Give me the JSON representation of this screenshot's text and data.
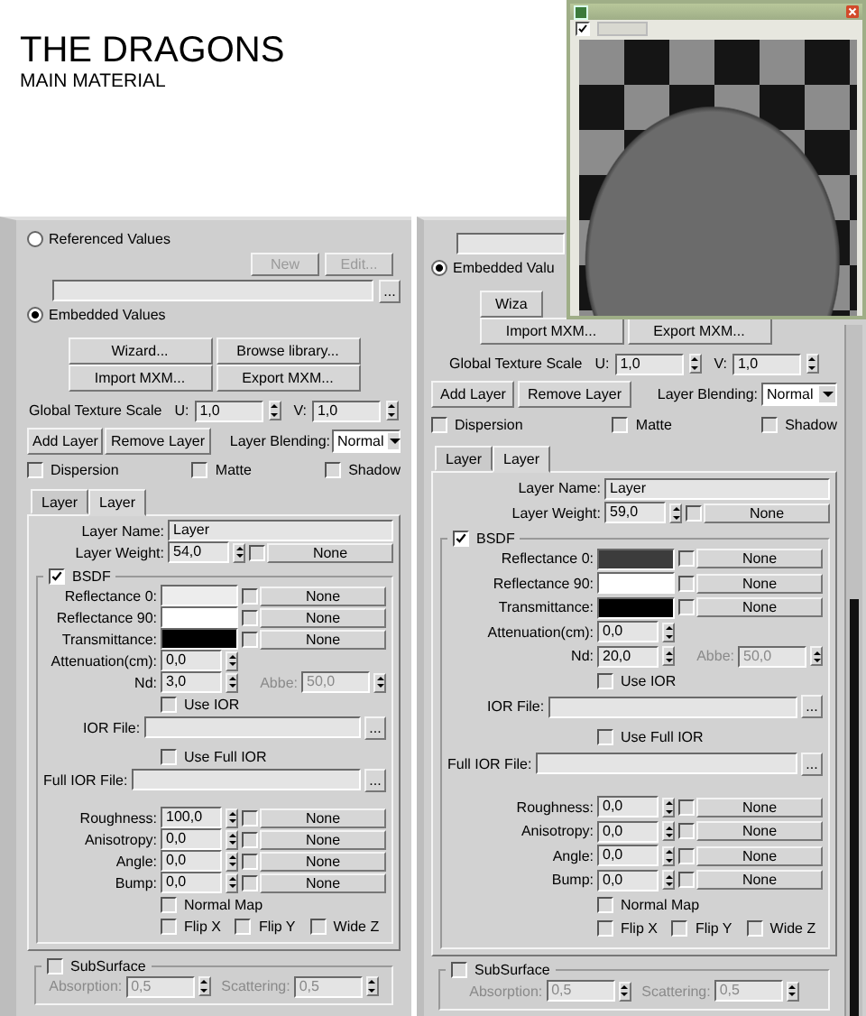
{
  "header": {
    "title": "THE DRAGONS",
    "subtitle": "MAIN MATERIAL"
  },
  "render_window": {
    "toolbar_checkbox": {
      "checked": true
    }
  },
  "panels": [
    {
      "reference": {
        "radio": {
          "label": "Referenced Values",
          "selected": false
        },
        "buttons": [
          {
            "label": "New",
            "disabled": true
          },
          {
            "label": "Edit...",
            "disabled": true
          }
        ]
      },
      "browse_button": "...",
      "embedded": {
        "label": "Embedded Values",
        "selected": true
      },
      "library_buttons": [
        [
          {
            "label": "Wizard..."
          },
          {
            "label": "Browse library..."
          }
        ],
        [
          {
            "label": "Import MXM..."
          },
          {
            "label": "Export MXM..."
          }
        ]
      ],
      "texture_scale": {
        "label": "Global Texture Scale",
        "u_label": "U:",
        "u": "1,0",
        "v_label": "V:",
        "v": "1,0"
      },
      "layer_buttons": [
        "Add Layer",
        "Remove Layer"
      ],
      "blending": {
        "label": "Layer Blending:",
        "value": "Normal"
      },
      "flags": [
        {
          "label": "Dispersion",
          "checked": false
        },
        {
          "label": "Matte",
          "checked": false
        },
        {
          "label": "Shadow",
          "checked": false
        }
      ],
      "tabs": [
        {
          "label": "Layer",
          "selected": false
        },
        {
          "label": "Layer",
          "selected": true
        }
      ],
      "layer": {
        "name_label": "Layer Name:",
        "name": "Layer",
        "weight_label": "Layer Weight:",
        "weight": "54,0",
        "weight_map": {
          "checked": false,
          "label": "None"
        },
        "bsdf": {
          "label": "BSDF",
          "checked": true,
          "colors": [
            {
              "label": "Reflectance 0:",
              "color": "#ededed",
              "map_checked": false,
              "map": "None"
            },
            {
              "label": "Reflectance 90:",
              "color": "#ffffff",
              "map_checked": false,
              "map": "None"
            },
            {
              "label": "Transmittance:",
              "color": "#000000",
              "map_checked": false,
              "map": "None"
            }
          ],
          "attenuation": {
            "label": "Attenuation(cm):",
            "value": "0,0"
          },
          "nd": {
            "label": "Nd:",
            "value": "3,0"
          },
          "abbe": {
            "label": "Abbe:",
            "value": "50,0",
            "disabled": true
          },
          "use_ior": {
            "label": "Use IOR",
            "checked": false
          },
          "ior_file": {
            "label": "IOR File:",
            "button": "..."
          },
          "use_full_ior": {
            "label": "Use Full IOR",
            "checked": false
          },
          "full_ior_file": {
            "label": "Full IOR File:",
            "button": "..."
          },
          "params": [
            {
              "label": "Roughness:",
              "value": "100,0",
              "map_checked": false,
              "map": "None"
            },
            {
              "label": "Anisotropy:",
              "value": "0,0",
              "map_checked": false,
              "map": "None"
            },
            {
              "label": "Angle:",
              "value": "0,0",
              "map_checked": false,
              "map": "None"
            },
            {
              "label": "Bump:",
              "value": "0,0",
              "map_checked": false,
              "map": "None"
            }
          ],
          "normal_map": {
            "label": "Normal Map",
            "checked": false
          },
          "flips": [
            {
              "label": "Flip X",
              "checked": false
            },
            {
              "label": "Flip Y",
              "checked": false
            },
            {
              "label": "Wide Z",
              "checked": false
            }
          ]
        },
        "subsurface": {
          "label": "SubSurface",
          "checked": false,
          "fields": [
            {
              "label": "Absorption:",
              "value": "0,5",
              "disabled": true
            },
            {
              "label": "Scattering:",
              "value": "0,5",
              "disabled": true
            }
          ]
        }
      }
    },
    {
      "embedded": {
        "label": "Embedded Valu",
        "selected": true
      },
      "library_buttons": [
        [
          {
            "label": "Wiza"
          }
        ],
        [
          {
            "label": "Import MXM..."
          },
          {
            "label": "Export MXM..."
          }
        ]
      ],
      "texture_scale": {
        "label": "Global Texture Scale",
        "u_label": "U:",
        "u": "1,0",
        "v_label": "V:",
        "v": "1,0"
      },
      "layer_buttons": [
        "Add Layer",
        "Remove Layer"
      ],
      "blending": {
        "label": "Layer Blending:",
        "value": "Normal"
      },
      "flags": [
        {
          "label": "Dispersion",
          "checked": false
        },
        {
          "label": "Matte",
          "checked": false
        },
        {
          "label": "Shadow",
          "checked": false
        }
      ],
      "tabs": [
        {
          "label": "Layer",
          "selected": false
        },
        {
          "label": "Layer",
          "selected": true
        }
      ],
      "layer": {
        "name_label": "Layer Name:",
        "name": "Layer",
        "weight_label": "Layer Weight:",
        "weight": "59,0",
        "weight_map": {
          "checked": false,
          "label": "None"
        },
        "bsdf": {
          "label": "BSDF",
          "checked": true,
          "colors": [
            {
              "label": "Reflectance 0:",
              "color": "#3c3c3c",
              "map_checked": false,
              "map": "None"
            },
            {
              "label": "Reflectance 90:",
              "color": "#ffffff",
              "map_checked": false,
              "map": "None"
            },
            {
              "label": "Transmittance:",
              "color": "#000000",
              "map_checked": false,
              "map": "None"
            }
          ],
          "attenuation": {
            "label": "Attenuation(cm):",
            "value": "0,0"
          },
          "nd": {
            "label": "Nd:",
            "value": "20,0"
          },
          "abbe": {
            "label": "Abbe:",
            "value": "50,0",
            "disabled": true
          },
          "use_ior": {
            "label": "Use IOR",
            "checked": false
          },
          "ior_file": {
            "label": "IOR File:",
            "button": "..."
          },
          "use_full_ior": {
            "label": "Use Full IOR",
            "checked": false
          },
          "full_ior_file": {
            "label": "Full IOR File:",
            "button": "..."
          },
          "params": [
            {
              "label": "Roughness:",
              "value": "0,0",
              "map_checked": false,
              "map": "None"
            },
            {
              "label": "Anisotropy:",
              "value": "0,0",
              "map_checked": false,
              "map": "None"
            },
            {
              "label": "Angle:",
              "value": "0,0",
              "map_checked": false,
              "map": "None"
            },
            {
              "label": "Bump:",
              "value": "0,0",
              "map_checked": false,
              "map": "None"
            }
          ],
          "normal_map": {
            "label": "Normal Map",
            "checked": false
          },
          "flips": [
            {
              "label": "Flip X",
              "checked": false
            },
            {
              "label": "Flip Y",
              "checked": false
            },
            {
              "label": "Wide Z",
              "checked": false
            }
          ]
        },
        "subsurface": {
          "label": "SubSurface",
          "checked": false,
          "fields": [
            {
              "label": "Absorption:",
              "value": "0,5",
              "disabled": true
            },
            {
              "label": "Scattering:",
              "value": "0,5",
              "disabled": true
            }
          ]
        }
      }
    }
  ]
}
